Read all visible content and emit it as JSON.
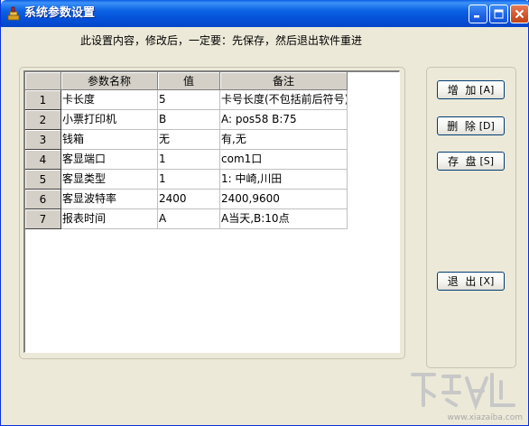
{
  "window": {
    "title": "系统参数设置"
  },
  "notice": "此设置内容，修改后，一定要：先保存，然后退出软件重进",
  "grid": {
    "columns": [
      "参数名称",
      "值",
      "备注"
    ],
    "rows": [
      {
        "num": "1",
        "name": "卡长度",
        "value": "5",
        "note": "卡号长度(不包括前后符号)"
      },
      {
        "num": "2",
        "name": "小票打印机",
        "value": "B",
        "note": "A: pos58   B:75"
      },
      {
        "num": "3",
        "name": "钱箱",
        "value": "无",
        "note": "有,无"
      },
      {
        "num": "4",
        "name": "客显端口",
        "value": "1",
        "note": "com1口"
      },
      {
        "num": "5",
        "name": "客显类型",
        "value": "1",
        "note": "1: 中崎,川田"
      },
      {
        "num": "6",
        "name": "客显波特率",
        "value": "2400",
        "note": "2400,9600"
      },
      {
        "num": "7",
        "name": "报表时间",
        "value": "A",
        "note": "A当天,B:10点"
      }
    ]
  },
  "buttons": {
    "add": "增  加",
    "add_key": "[A]",
    "delete": "删  除",
    "delete_key": "[D]",
    "save": "存  盘",
    "save_key": "[S]",
    "exit": "退  出",
    "exit_key": "[X]"
  },
  "watermark": {
    "text": "www.xiazaiba.com"
  },
  "colors": {
    "titlebar": "#0550d8",
    "window_bg": "#ece9d8",
    "grid_header": "#d4d0c8"
  }
}
